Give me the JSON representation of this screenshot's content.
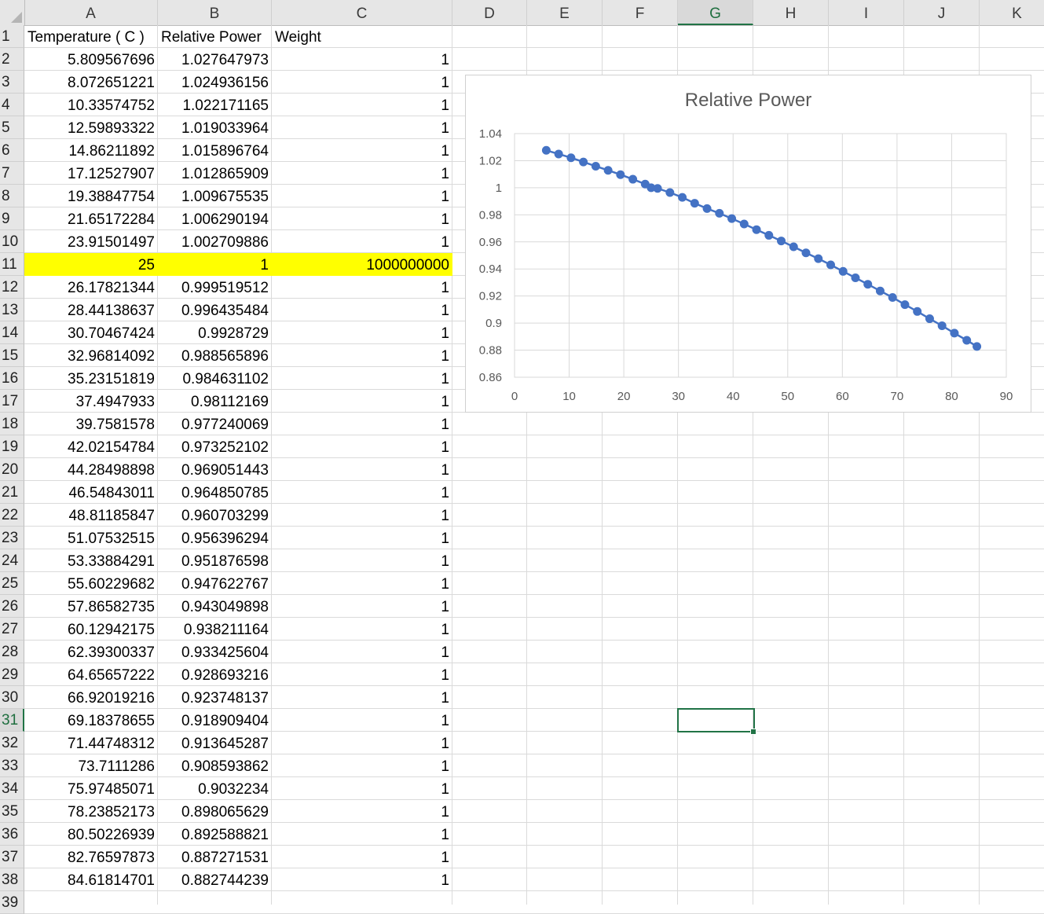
{
  "sheet": {
    "columns": [
      "A",
      "B",
      "C",
      "D",
      "E",
      "F",
      "G",
      "H",
      "I",
      "J",
      "K"
    ],
    "active_column": "G",
    "active_row": "31",
    "rows": [
      {
        "n": "1",
        "a": "Temperature ( C )",
        "b": "Relative Power",
        "c": "Weight"
      },
      {
        "n": "2",
        "a": "5.809567696",
        "b": "1.027647973",
        "c": "1"
      },
      {
        "n": "3",
        "a": "8.072651221",
        "b": "1.024936156",
        "c": "1"
      },
      {
        "n": "4",
        "a": "10.33574752",
        "b": "1.022171165",
        "c": "1"
      },
      {
        "n": "5",
        "a": "12.59893322",
        "b": "1.019033964",
        "c": "1"
      },
      {
        "n": "6",
        "a": "14.86211892",
        "b": "1.015896764",
        "c": "1"
      },
      {
        "n": "7",
        "a": "17.12527907",
        "b": "1.012865909",
        "c": "1"
      },
      {
        "n": "8",
        "a": "19.38847754",
        "b": "1.009675535",
        "c": "1"
      },
      {
        "n": "9",
        "a": "21.65172284",
        "b": "1.006290194",
        "c": "1"
      },
      {
        "n": "10",
        "a": "23.91501497",
        "b": "1.002709886",
        "c": "1"
      },
      {
        "n": "11",
        "a": "25",
        "b": "1",
        "c": "1000000000",
        "highlight": true
      },
      {
        "n": "12",
        "a": "26.17821344",
        "b": "0.999519512",
        "c": "1"
      },
      {
        "n": "13",
        "a": "28.44138637",
        "b": "0.996435484",
        "c": "1"
      },
      {
        "n": "14",
        "a": "30.70467424",
        "b": "0.9928729",
        "c": "1"
      },
      {
        "n": "15",
        "a": "32.96814092",
        "b": "0.988565896",
        "c": "1"
      },
      {
        "n": "16",
        "a": "35.23151819",
        "b": "0.984631102",
        "c": "1"
      },
      {
        "n": "17",
        "a": "37.4947933",
        "b": "0.98112169",
        "c": "1"
      },
      {
        "n": "18",
        "a": "39.7581578",
        "b": "0.977240069",
        "c": "1"
      },
      {
        "n": "19",
        "a": "42.02154784",
        "b": "0.973252102",
        "c": "1"
      },
      {
        "n": "20",
        "a": "44.28498898",
        "b": "0.969051443",
        "c": "1"
      },
      {
        "n": "21",
        "a": "46.54843011",
        "b": "0.964850785",
        "c": "1"
      },
      {
        "n": "22",
        "a": "48.81185847",
        "b": "0.960703299",
        "c": "1"
      },
      {
        "n": "23",
        "a": "51.07532515",
        "b": "0.956396294",
        "c": "1"
      },
      {
        "n": "24",
        "a": "53.33884291",
        "b": "0.951876598",
        "c": "1"
      },
      {
        "n": "25",
        "a": "55.60229682",
        "b": "0.947622767",
        "c": "1"
      },
      {
        "n": "26",
        "a": "57.86582735",
        "b": "0.943049898",
        "c": "1"
      },
      {
        "n": "27",
        "a": "60.12942175",
        "b": "0.938211164",
        "c": "1"
      },
      {
        "n": "28",
        "a": "62.39300337",
        "b": "0.933425604",
        "c": "1"
      },
      {
        "n": "29",
        "a": "64.65657222",
        "b": "0.928693216",
        "c": "1"
      },
      {
        "n": "30",
        "a": "66.92019216",
        "b": "0.923748137",
        "c": "1"
      },
      {
        "n": "31",
        "a": "69.18378655",
        "b": "0.918909404",
        "c": "1"
      },
      {
        "n": "32",
        "a": "71.44748312",
        "b": "0.913645287",
        "c": "1"
      },
      {
        "n": "33",
        "a": "73.7111286",
        "b": "0.908593862",
        "c": "1"
      },
      {
        "n": "34",
        "a": "75.97485071",
        "b": "0.9032234",
        "c": "1"
      },
      {
        "n": "35",
        "a": "78.23852173",
        "b": "0.898065629",
        "c": "1"
      },
      {
        "n": "36",
        "a": "80.50226939",
        "b": "0.892588821",
        "c": "1"
      },
      {
        "n": "37",
        "a": "82.76597873",
        "b": "0.887271531",
        "c": "1"
      },
      {
        "n": "38",
        "a": "84.61814701",
        "b": "0.882744239",
        "c": "1"
      },
      {
        "n": "39",
        "a": "",
        "b": "",
        "c": ""
      }
    ]
  },
  "chart_data": {
    "type": "scatter",
    "title": "Relative Power",
    "xlabel": "",
    "ylabel": "",
    "xlim": [
      0,
      90
    ],
    "ylim": [
      0.86,
      1.04
    ],
    "x_ticks": [
      "0",
      "10",
      "20",
      "30",
      "40",
      "50",
      "60",
      "70",
      "80",
      "90"
    ],
    "y_ticks": [
      "0.86",
      "0.88",
      "0.9",
      "0.92",
      "0.94",
      "0.96",
      "0.98",
      "1",
      "1.02",
      "1.04"
    ],
    "grid": true,
    "legend": "none",
    "series_color": "#4472c4",
    "series": [
      {
        "x": [
          5.809567696,
          8.072651221,
          10.33574752,
          12.59893322,
          14.86211892,
          17.12527907,
          19.38847754,
          21.65172284,
          23.91501497,
          25,
          26.17821344,
          28.44138637,
          30.70467424,
          32.96814092,
          35.23151819,
          37.4947933,
          39.7581578,
          42.02154784,
          44.28498898,
          46.54843011,
          48.81185847,
          51.07532515,
          53.33884291,
          55.60229682,
          57.86582735,
          60.12942175,
          62.39300337,
          64.65657222,
          66.92019216,
          69.18378655,
          71.44748312,
          73.7111286,
          75.97485071,
          78.23852173,
          80.50226939,
          82.76597873,
          84.61814701
        ],
        "y": [
          1.027647973,
          1.024936156,
          1.022171165,
          1.019033964,
          1.015896764,
          1.012865909,
          1.009675535,
          1.006290194,
          1.002709886,
          1,
          0.999519512,
          0.996435484,
          0.9928729,
          0.988565896,
          0.984631102,
          0.98112169,
          0.977240069,
          0.973252102,
          0.969051443,
          0.964850785,
          0.960703299,
          0.956396294,
          0.951876598,
          0.947622767,
          0.943049898,
          0.938211164,
          0.933425604,
          0.928693216,
          0.923748137,
          0.918909404,
          0.913645287,
          0.908593862,
          0.9032234,
          0.898065629,
          0.892588821,
          0.887271531,
          0.882744239
        ]
      }
    ]
  }
}
